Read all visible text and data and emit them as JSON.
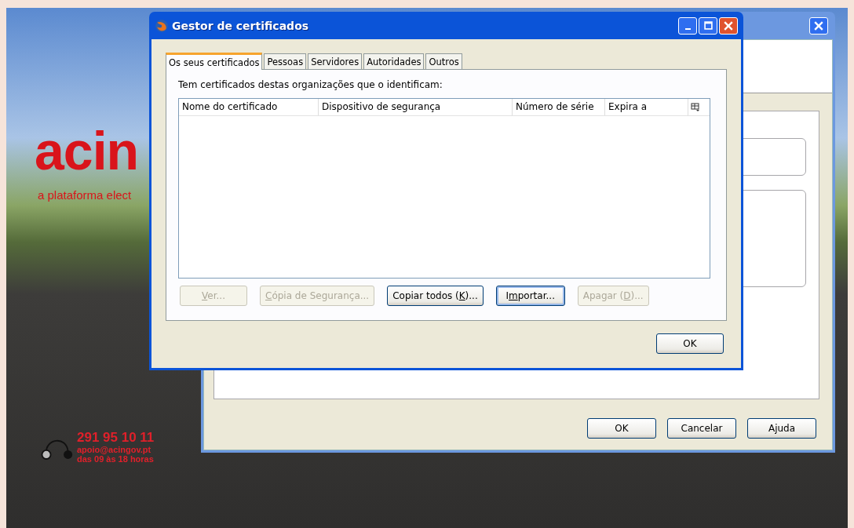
{
  "wallpaper": {
    "logo": "acin",
    "tagline": "a plataforma elect",
    "phone": "291 95 10 11",
    "email": "apoio@acingov.pt",
    "hours": "das 09 às 18 horas"
  },
  "back_window": {
    "buttons": [
      {
        "label": "OK"
      },
      {
        "label": "Cancelar"
      },
      {
        "label": "Ajuda"
      }
    ]
  },
  "dialog": {
    "title": "Gestor de certificados",
    "tabs": [
      {
        "label": "Os seus certificados",
        "selected": true
      },
      {
        "label": "Pessoas",
        "selected": false
      },
      {
        "label": "Servidores",
        "selected": false
      },
      {
        "label": "Autoridades",
        "selected": false
      },
      {
        "label": "Outros",
        "selected": false
      }
    ],
    "description": "Tem certificados destas organizações que o identificam:",
    "table": {
      "columns": [
        "Nome do certificado",
        "Dispositivo de segurança",
        "Número de série",
        "Expira a"
      ]
    },
    "actions": [
      {
        "label": [
          {
            "text": "V",
            "underlined": true
          },
          {
            "text": "er...",
            "underlined": false
          }
        ],
        "disabled": true,
        "focused": false
      },
      {
        "label": [
          {
            "text": "C",
            "underlined": true
          },
          {
            "text": "ópia de Segurança...",
            "underlined": false
          }
        ],
        "disabled": true,
        "focused": false
      },
      {
        "label": [
          {
            "text": "Copiar todos (",
            "underlined": false
          },
          {
            "text": "K",
            "underlined": true
          },
          {
            "text": ")...",
            "underlined": false
          }
        ],
        "disabled": false,
        "focused": false
      },
      {
        "label": [
          {
            "text": "I",
            "underlined": false
          },
          {
            "text": "m",
            "underlined": true
          },
          {
            "text": "portar...",
            "underlined": false
          }
        ],
        "disabled": false,
        "focused": true
      },
      {
        "label": [
          {
            "text": "Apagar (",
            "underlined": false
          },
          {
            "text": "D",
            "underlined": true
          },
          {
            "text": ")...",
            "underlined": false
          }
        ],
        "disabled": true,
        "focused": false
      }
    ],
    "ok": {
      "label": "OK"
    }
  }
}
